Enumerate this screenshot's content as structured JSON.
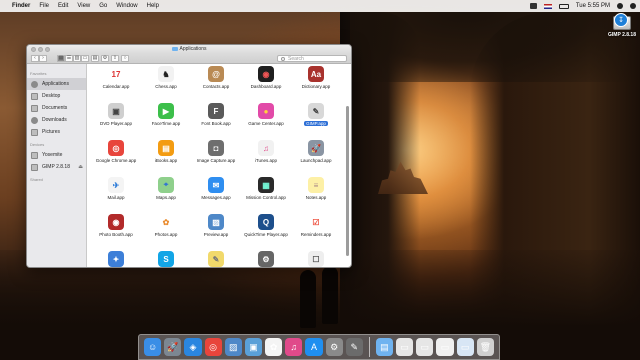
{
  "menubar": {
    "apple_glyph": "",
    "items": [
      "Finder",
      "File",
      "Edit",
      "View",
      "Go",
      "Window",
      "Help"
    ],
    "clock": "Tue 5:55 PM",
    "icons": [
      "status-icon",
      "flag-icon",
      "battery-icon",
      "search-icon",
      "notification-icon"
    ]
  },
  "desktop": {
    "disk_label": "GIMP 2.8.18",
    "disk_badge": "↧"
  },
  "finder": {
    "title": "Applications",
    "search_placeholder": "Search",
    "toolbar": {
      "back": "‹",
      "forward": "›",
      "view_icons": "▦",
      "view_list": "☰",
      "view_columns": "▥",
      "view_coverflow": "▭",
      "arrange": "▤",
      "action": "⚙",
      "share": "⇪",
      "tag": "○"
    },
    "sidebar": {
      "favorites_heading": "Favorites",
      "favorites": [
        "Applications",
        "Desktop",
        "Documents",
        "Downloads",
        "Pictures"
      ],
      "devices_heading": "Devices",
      "devices": [
        "Yosemite",
        "GIMP 2.8.18"
      ],
      "shared_heading": "Shared",
      "eject_glyph": "⏏"
    },
    "apps": [
      {
        "name": "Calendar.app",
        "color": "#ffffff",
        "glyph": "17",
        "fg": "#d33"
      },
      {
        "name": "Chess.app",
        "color": "#f2f2f2",
        "glyph": "♞",
        "fg": "#222"
      },
      {
        "name": "Contacts.app",
        "color": "#b98a54",
        "glyph": "@",
        "fg": "#fff"
      },
      {
        "name": "Dashboard.app",
        "color": "#1f1f1f",
        "glyph": "◉",
        "fg": "#e55"
      },
      {
        "name": "Dictionary.app",
        "color": "#a8322d",
        "glyph": "Aa",
        "fg": "#fff"
      },
      {
        "name": "DVD Player.app",
        "color": "#cfcfcf",
        "glyph": "▣",
        "fg": "#444"
      },
      {
        "name": "FaceTime.app",
        "color": "#3cbf4a",
        "glyph": "▶",
        "fg": "#fff"
      },
      {
        "name": "Font Book.app",
        "color": "#5a5a5a",
        "glyph": "F",
        "fg": "#fff"
      },
      {
        "name": "Game Center.app",
        "color": "#e24aa8",
        "glyph": "●",
        "fg": "#ffd23f"
      },
      {
        "name": "GIMP.app",
        "color": "#d8d8d8",
        "glyph": "✎",
        "fg": "#444"
      },
      {
        "name": "Google Chrome.app",
        "color": "#e8453c",
        "glyph": "◎",
        "fg": "#fff"
      },
      {
        "name": "iBooks.app",
        "color": "#f39c12",
        "glyph": "▤",
        "fg": "#fff"
      },
      {
        "name": "Image Capture.app",
        "color": "#6e6e6e",
        "glyph": "◘",
        "fg": "#fff"
      },
      {
        "name": "iTunes.app",
        "color": "#f1f1f1",
        "glyph": "♫",
        "fg": "#e04a8a"
      },
      {
        "name": "Launchpad.app",
        "color": "#8a95a3",
        "glyph": "🚀",
        "fg": "#fff"
      },
      {
        "name": "Mail.app",
        "color": "#f4f4f4",
        "glyph": "✈",
        "fg": "#2a7ad8"
      },
      {
        "name": "Maps.app",
        "color": "#8fd08c",
        "glyph": "⌖",
        "fg": "#2d6fd6"
      },
      {
        "name": "Messages.app",
        "color": "#2f8ef0",
        "glyph": "✉",
        "fg": "#fff"
      },
      {
        "name": "Mission Control.app",
        "color": "#2a2a2a",
        "glyph": "▦",
        "fg": "#7fd"
      },
      {
        "name": "Notes.app",
        "color": "#fdf0a6",
        "glyph": "≡",
        "fg": "#a88"
      },
      {
        "name": "Photo Booth.app",
        "color": "#b22a2a",
        "glyph": "◉",
        "fg": "#fff"
      },
      {
        "name": "Photos.app",
        "color": "#ffffff",
        "glyph": "✿",
        "fg": "#e98b2e"
      },
      {
        "name": "Preview.app",
        "color": "#4e88c8",
        "glyph": "▨",
        "fg": "#fff"
      },
      {
        "name": "QuickTime Player.app",
        "color": "#1d4f8c",
        "glyph": "Q",
        "fg": "#fff"
      },
      {
        "name": "Reminders.app",
        "color": "#ffffff",
        "glyph": "☑",
        "fg": "#e54"
      },
      {
        "name": "",
        "color": "#3d7fd8",
        "glyph": "✦",
        "fg": "#fff"
      },
      {
        "name": "",
        "color": "#12a5e6",
        "glyph": "S",
        "fg": "#fff"
      },
      {
        "name": "",
        "color": "#f1d96b",
        "glyph": "✎",
        "fg": "#777"
      },
      {
        "name": "",
        "color": "#666666",
        "glyph": "⚙",
        "fg": "#fff"
      },
      {
        "name": "",
        "color": "#eeeeee",
        "glyph": "☐",
        "fg": "#555"
      }
    ],
    "highlighted_app": "GIMP.app"
  },
  "dock": {
    "items": [
      {
        "name": "finder",
        "color": "#3a8ee6",
        "glyph": "☺"
      },
      {
        "name": "launchpad",
        "color": "#7c8792",
        "glyph": "🚀"
      },
      {
        "name": "safari",
        "color": "#2a86e0",
        "glyph": "◈"
      },
      {
        "name": "chrome",
        "color": "#e8453c",
        "glyph": "◎"
      },
      {
        "name": "preview",
        "color": "#4e88c8",
        "glyph": "▨"
      },
      {
        "name": "image-viewer",
        "color": "#5aa0d8",
        "glyph": "▣"
      },
      {
        "name": "photos",
        "color": "#f4f4f4",
        "glyph": "✿"
      },
      {
        "name": "itunes",
        "color": "#e04a8a",
        "glyph": "♫"
      },
      {
        "name": "app-store",
        "color": "#1f8ff0",
        "glyph": "A"
      },
      {
        "name": "system-preferences",
        "color": "#8a8a8a",
        "glyph": "⚙"
      },
      {
        "name": "gimp",
        "color": "#6b6b6b",
        "glyph": "✎"
      }
    ],
    "right_items": [
      {
        "name": "applications-folder",
        "color": "#6fb3f0",
        "glyph": "▤"
      },
      {
        "name": "window-1",
        "color": "#e6e6e6",
        "glyph": "▭"
      },
      {
        "name": "window-2",
        "color": "#e6e6e6",
        "glyph": "▭"
      },
      {
        "name": "window-3",
        "color": "#f0f0f0",
        "glyph": "▭"
      },
      {
        "name": "window-4",
        "color": "#d8e6f5",
        "glyph": "▭"
      },
      {
        "name": "trash",
        "color": "#d0d0d0",
        "glyph": "🗑"
      }
    ]
  }
}
